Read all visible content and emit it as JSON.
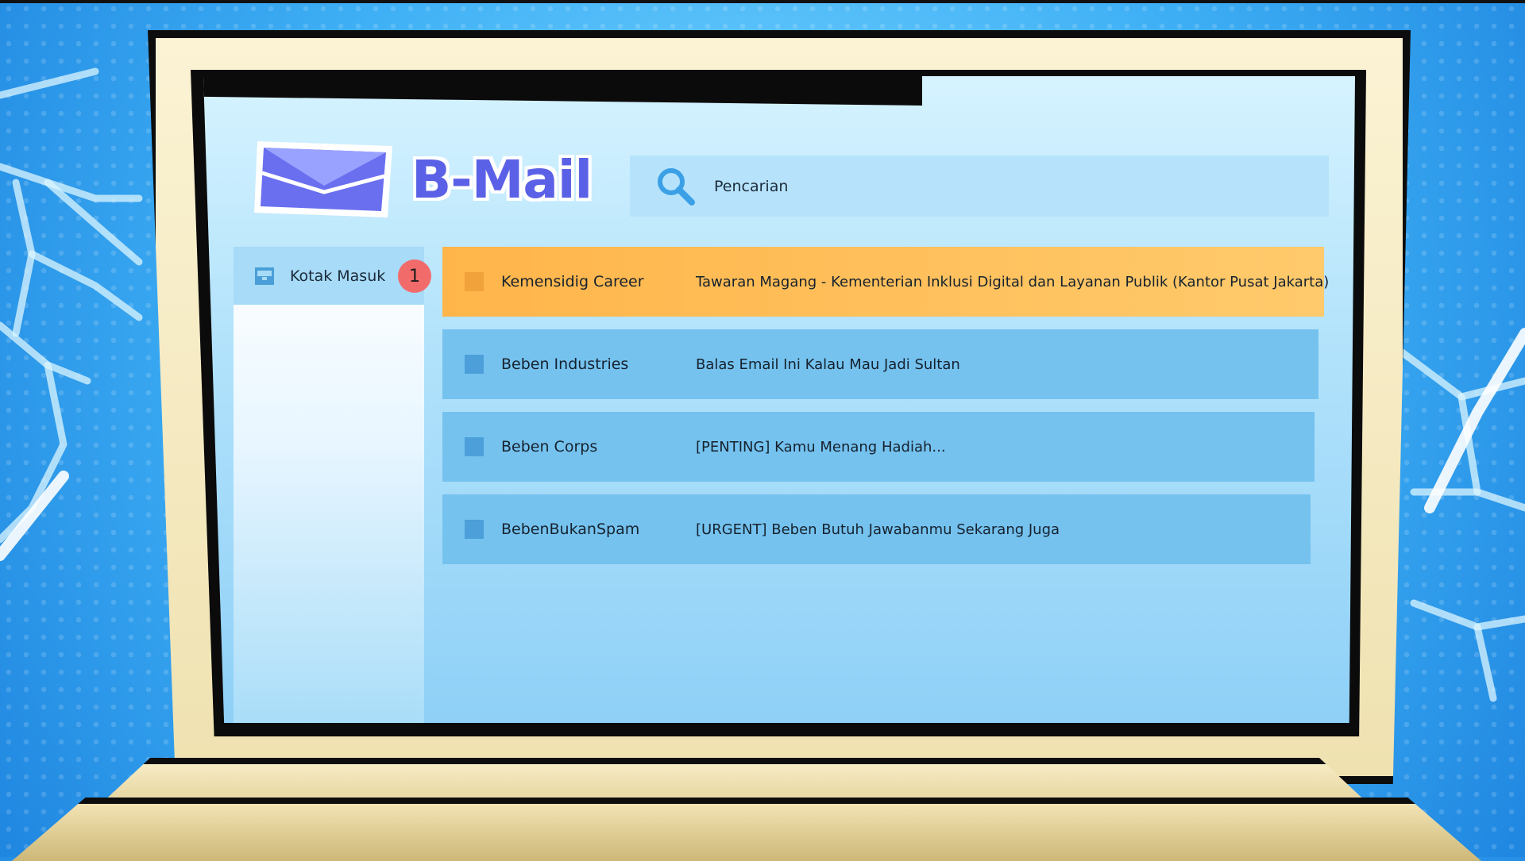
{
  "app": {
    "name": "B-Mail"
  },
  "search": {
    "placeholder": "Pencarian"
  },
  "sidebar": {
    "items": [
      {
        "label": "Kotak Masuk",
        "icon": "inbox-icon",
        "badge": "1"
      }
    ]
  },
  "emails": [
    {
      "sender": "Kemensidig Career",
      "subject": "Tawaran Magang - Kementerian Inklusi Digital dan Layanan Publik (Kantor Pusat Jakarta)",
      "highlighted": true
    },
    {
      "sender": "Beben Industries",
      "subject": "Balas Email Ini Kalau Mau Jadi Sultan",
      "highlighted": false
    },
    {
      "sender": "Beben Corps",
      "subject": "[PENTING] Kamu Menang Hadiah...",
      "highlighted": false
    },
    {
      "sender": "BebenBukanSpam",
      "subject": "[URGENT] Beben Butuh Jawabanmu Sekarang Juga",
      "highlighted": false
    }
  ],
  "colors": {
    "brand": "#5b61e6",
    "highlight_row": "#ffbf55",
    "row": "#75c2ef",
    "badge": "#f26b6b"
  }
}
